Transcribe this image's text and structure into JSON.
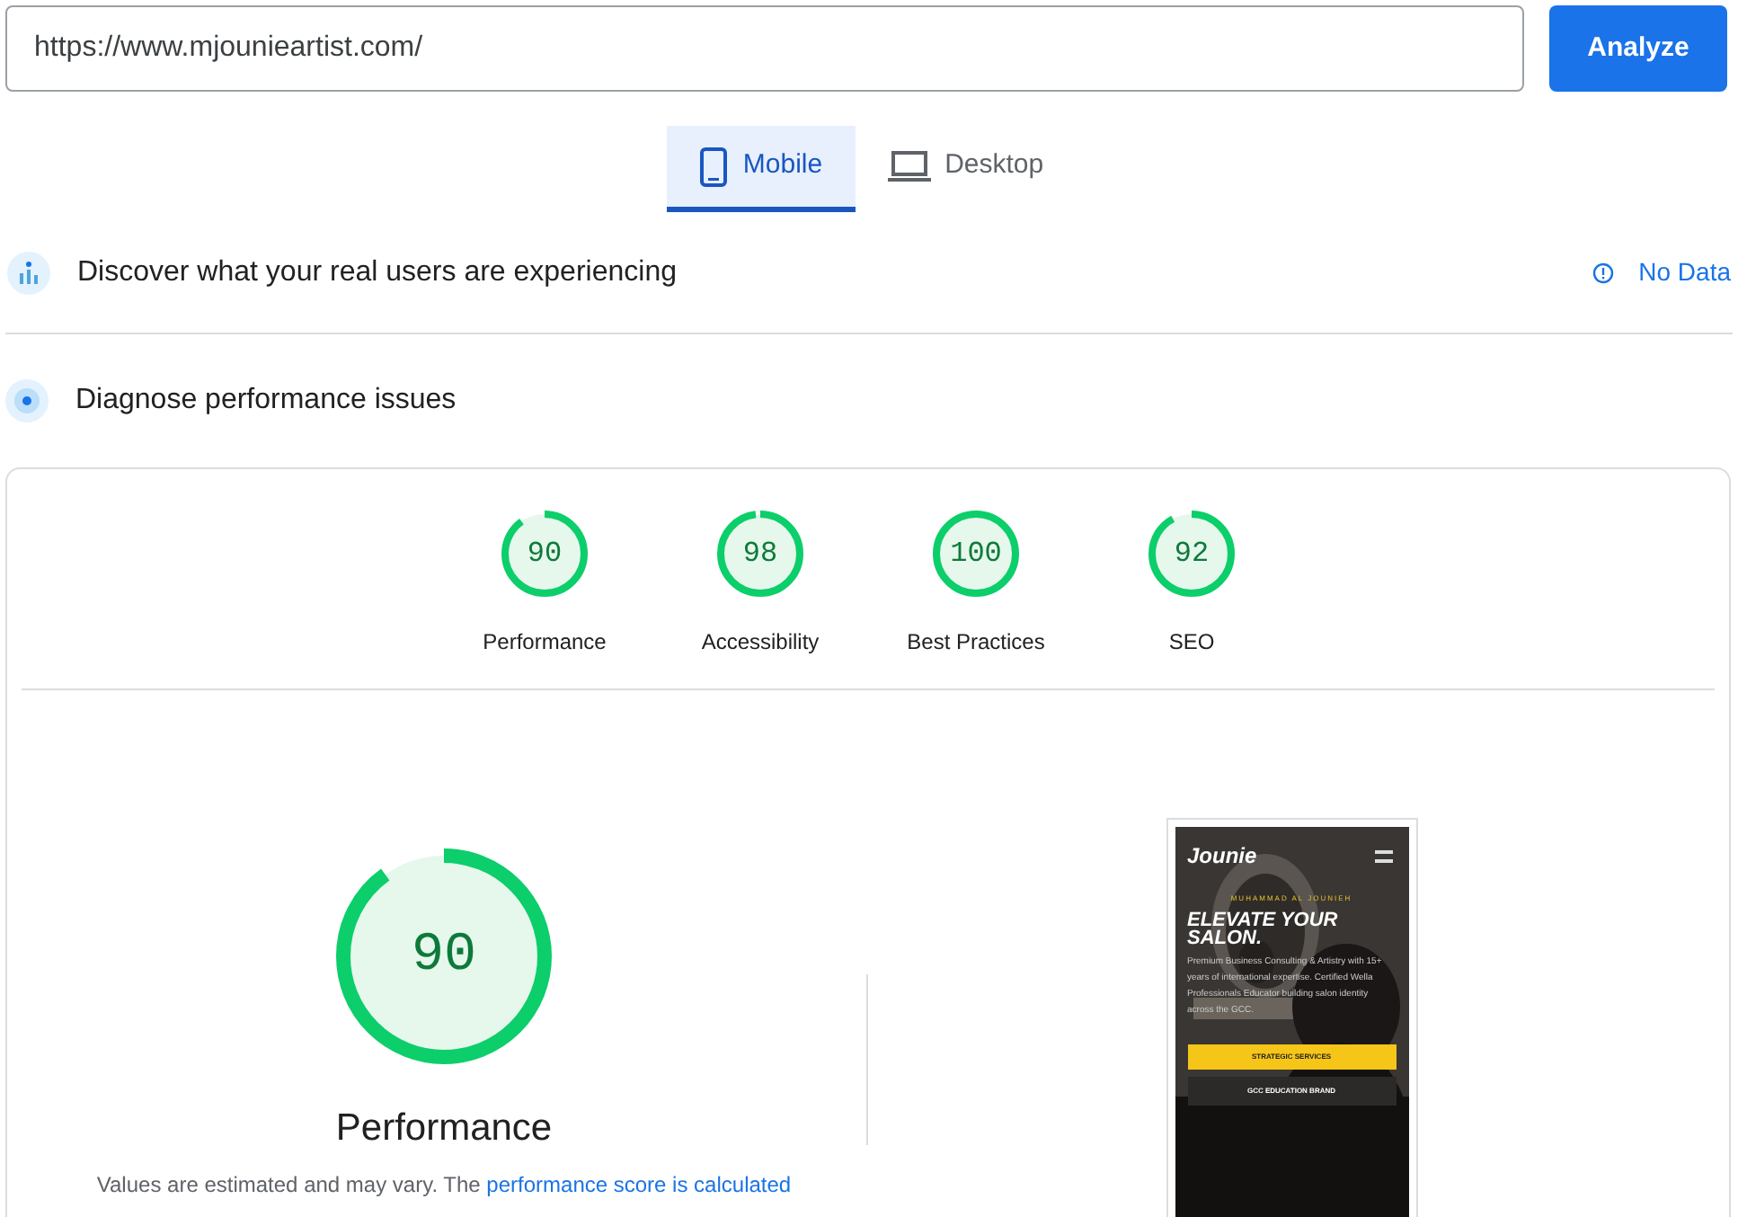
{
  "url_field": {
    "value": "https://www.mjounieartist.com/"
  },
  "analyze_button": "Analyze",
  "tabs": [
    {
      "label": "Mobile",
      "kind": "phone",
      "selected": true
    },
    {
      "label": "Desktop",
      "kind": "laptop",
      "selected": false
    }
  ],
  "field_data": {
    "title": "Discover what your real users are experiencing",
    "status": "No Data"
  },
  "lab_data": {
    "title": "Diagnose performance issues"
  },
  "scores": [
    {
      "score": "90",
      "label": "Performance",
      "level": 0.9
    },
    {
      "score": "98",
      "label": "Accessibility",
      "level": 0.98
    },
    {
      "score": "100",
      "label": "Best Practices",
      "level": 1
    },
    {
      "score": "92",
      "label": "SEO",
      "level": 0.92
    }
  ],
  "main_score": {
    "score": "90",
    "label": "Performance",
    "level": 0.9,
    "note": "Values are estimated and may vary. The ",
    "note_link": "performance score is calculated"
  },
  "site_preview": {
    "logo": "Jounie",
    "eyebrow": "MUHAMMAD AL JOUNIEH",
    "headline": "ELEVATE YOUR SALON.",
    "body": "Premium Business Consulting & Artistry with 15+ years of international expertise. Certified Wella Professionals Educator building salon identity across the GCC.",
    "primary_button": "STRATEGIC SERVICES",
    "secondary_button": "GCC EDUCATION BRAND"
  }
}
